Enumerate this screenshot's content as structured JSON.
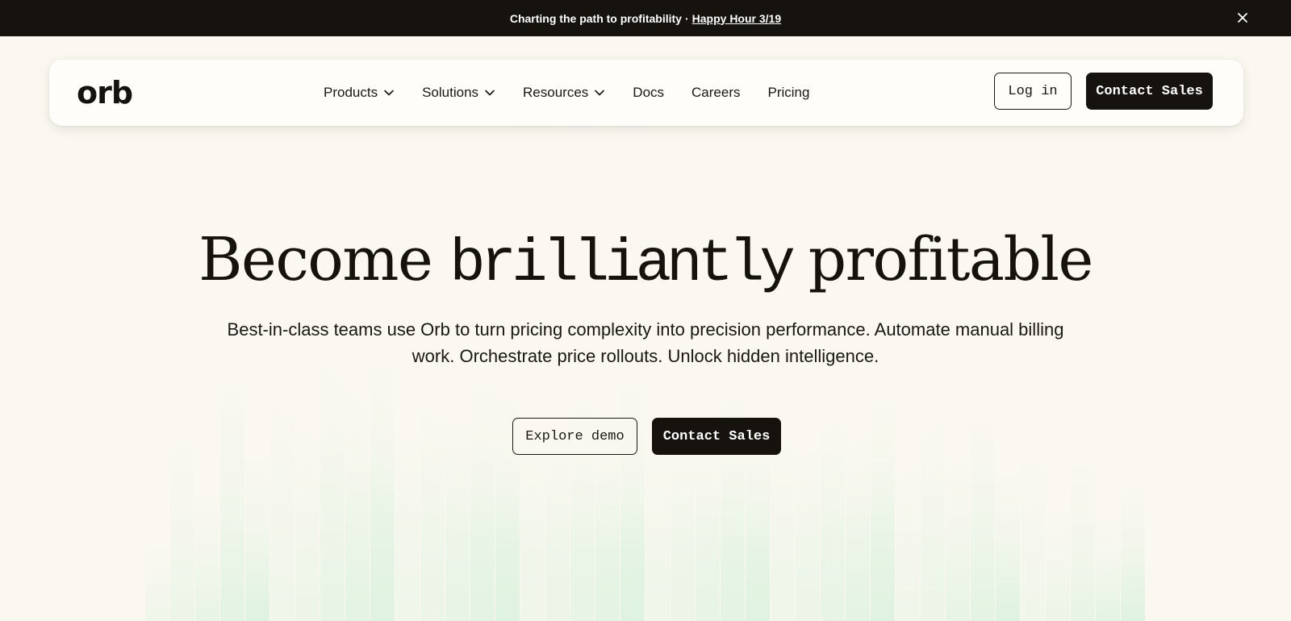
{
  "announcement": {
    "text": "Charting the path to profitability",
    "separator": "·",
    "link_label": "Happy Hour 3/19",
    "close_icon": "close-icon"
  },
  "nav": {
    "logo": "orb",
    "items": [
      {
        "label": "Products",
        "has_dropdown": true
      },
      {
        "label": "Solutions",
        "has_dropdown": true
      },
      {
        "label": "Resources",
        "has_dropdown": true
      },
      {
        "label": "Docs",
        "has_dropdown": false
      },
      {
        "label": "Careers",
        "has_dropdown": false
      },
      {
        "label": "Pricing",
        "has_dropdown": false
      }
    ],
    "login_label": "Log in",
    "contact_label": "Contact Sales"
  },
  "hero": {
    "title_part1": "Become ",
    "title_part2": "brilliantly",
    "title_part3": " profitable",
    "subtitle": "Best-in-class teams use Orb to turn pricing complexity into precision performance. Automate manual billing work. Orchestrate price rollouts. Unlock hidden intelligence.",
    "demo_label": "Explore demo",
    "contact_label": "Contact Sales"
  },
  "colors": {
    "background": "#fbf8f1",
    "dark": "#16120e",
    "accent_green": "#bfe9cd"
  }
}
